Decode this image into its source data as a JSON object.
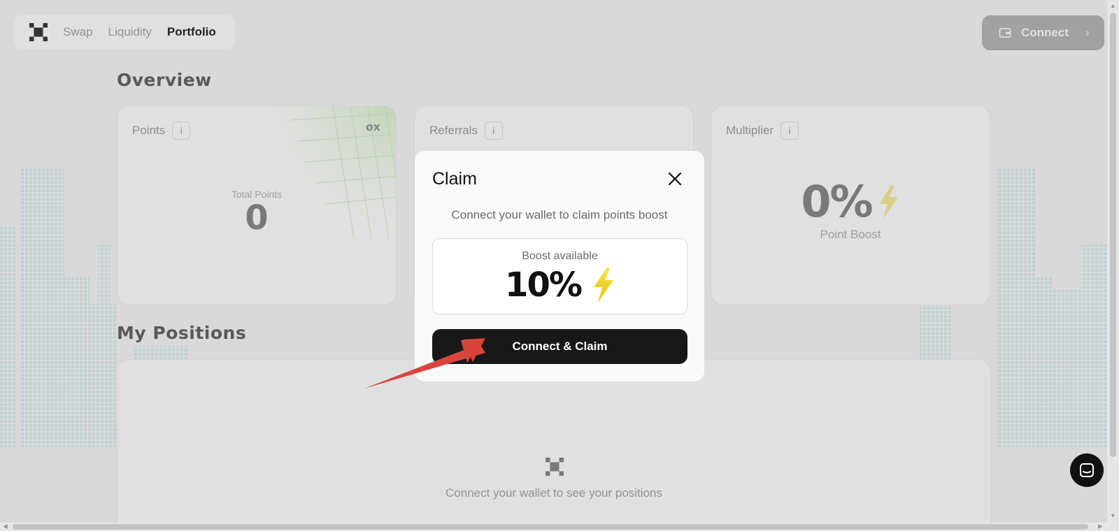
{
  "nav": {
    "logo_icon": "ox-logo-icon",
    "links": [
      {
        "label": "Swap"
      },
      {
        "label": "Liquidity"
      },
      {
        "label": "Portfolio",
        "active": true
      }
    ]
  },
  "header": {
    "connect_label": "Connect",
    "wallet_icon": "wallet-icon",
    "chevron_icon": "chevron-right-icon"
  },
  "overview": {
    "title": "Overview",
    "points_card": {
      "title": "Points",
      "info_label": "i",
      "badge": "ox",
      "total_label": "Total Points",
      "total_value": "0"
    },
    "referrals_card": {
      "title": "Referrals",
      "info_label": "i"
    },
    "multiplier_card": {
      "title": "Multiplier",
      "info_label": "i",
      "value": "0%",
      "label": "Point Boost",
      "icon": "lightning-icon"
    }
  },
  "positions": {
    "title": "My Positions",
    "empty_text": "Connect your wallet to see your positions"
  },
  "modal": {
    "title": "Claim",
    "subtitle": "Connect your wallet to claim points boost",
    "boost_label": "Boost available",
    "boost_value": "10%",
    "boost_icon": "lightning-icon",
    "button_label": "Connect & Claim",
    "close_icon": "close-icon"
  },
  "annotation": {
    "arrow_color": "#d9443c",
    "points_to": "Connect & Claim"
  },
  "chat": {
    "icon": "chat-icon"
  },
  "colors": {
    "accent_dark": "#181818",
    "lightning_yellow": "#f2d21b"
  }
}
